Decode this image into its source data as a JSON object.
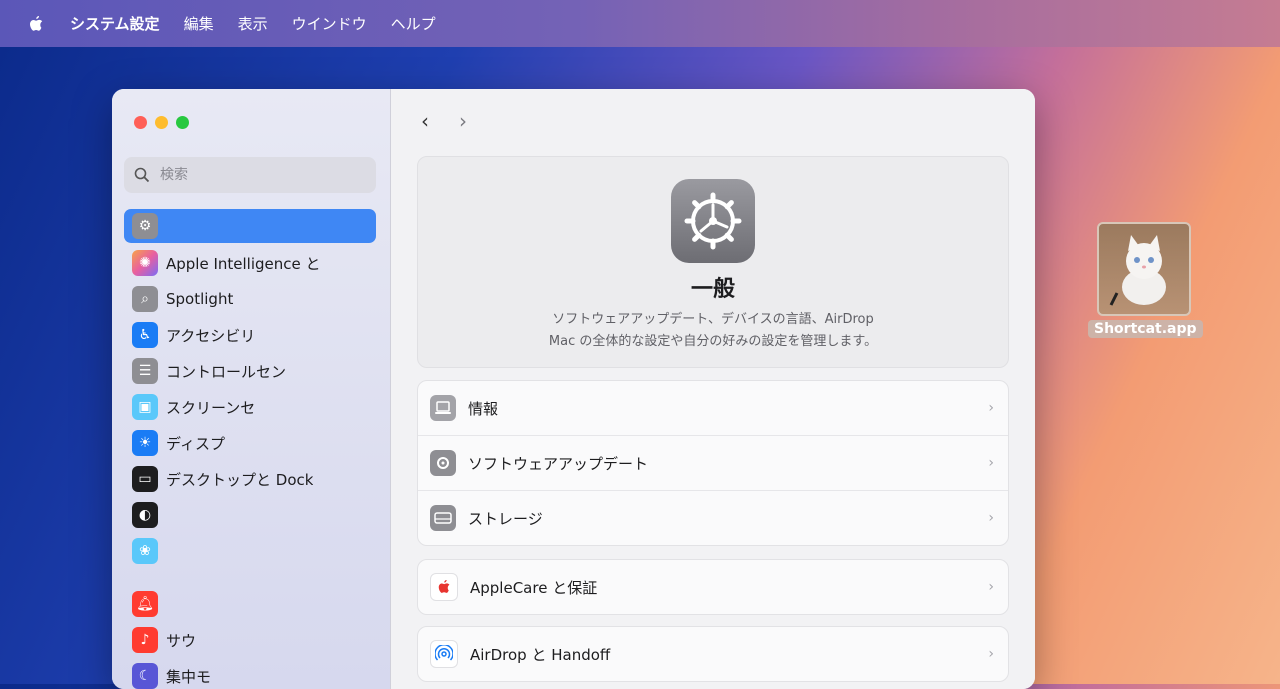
{
  "menubar": {
    "app_name": "システム設定",
    "items": [
      "編集",
      "表示",
      "ウインドウ",
      "ヘルプ"
    ]
  },
  "sidebar": {
    "search_placeholder": "検索",
    "items": [
      {
        "label": "",
        "icon": "gear-icon",
        "color": "#8e8e93",
        "selected": true
      },
      {
        "label": "Apple Intelligence と",
        "icon": "apple-intelligence-icon",
        "color": "#e85fa0"
      },
      {
        "label": "Spotlight",
        "icon": "magnifier-icon",
        "color": "#8e8e93"
      },
      {
        "label": "アクセシビリ",
        "icon": "accessibility-icon",
        "color": "#1a7cf5"
      },
      {
        "label": "コントロールセン",
        "icon": "toggles-icon",
        "color": "#8e8e93"
      },
      {
        "label": "スクリーンセ",
        "icon": "screensaver-icon",
        "color": "#5ac8fa"
      },
      {
        "label": "ディスプ",
        "icon": "sun-icon",
        "color": "#1a7cf5"
      },
      {
        "label": "デスクトップと Dock",
        "icon": "dock-icon",
        "color": "#1d1d1f"
      },
      {
        "label": "",
        "icon": "appearance-icon",
        "color": "#1d1d1f"
      },
      {
        "label": "",
        "icon": "wallpaper-icon",
        "color": "#5ac8fa"
      },
      {
        "label": "",
        "icon": "bell-icon",
        "color": "#ff3b30"
      },
      {
        "label": "サウ",
        "icon": "speaker-icon",
        "color": "#ff3b30"
      },
      {
        "label": "集中モ",
        "icon": "moon-icon",
        "color": "#5856d6"
      }
    ]
  },
  "content": {
    "hero_title": "一般",
    "hero_desc_1": "ソフトウェアアップデート、デバイスの言語、AirDrop",
    "hero_desc_2": "Mac の全体的な設定や自分の好みの設定を管理します。",
    "group1": [
      {
        "label": "情報",
        "icon": "laptop-icon"
      },
      {
        "label": "ソフトウェアアップデート",
        "icon": "gear-icon"
      },
      {
        "label": "ストレージ",
        "icon": "drive-icon"
      }
    ],
    "group2": [
      {
        "label": "AppleCare と保証",
        "icon": "apple-logo-icon"
      }
    ],
    "group3": [
      {
        "label": "AirDrop と Handoff",
        "icon": "airdrop-icon"
      }
    ]
  },
  "desktop": {
    "file_name": "Shortcat.app"
  }
}
